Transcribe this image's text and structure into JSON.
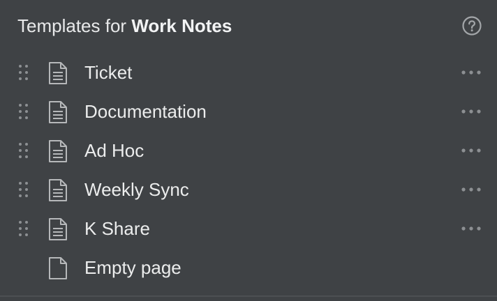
{
  "header": {
    "title_prefix": "Templates for",
    "title_bold": "Work Notes",
    "help_icon": "question-circle-icon"
  },
  "templates": [
    {
      "label": "Ticket",
      "icon": "document-lines-icon"
    },
    {
      "label": "Documentation",
      "icon": "document-lines-icon"
    },
    {
      "label": "Ad Hoc",
      "icon": "document-lines-icon"
    },
    {
      "label": "Weekly Sync",
      "icon": "document-lines-icon"
    },
    {
      "label": "K Share",
      "icon": "document-lines-icon"
    }
  ],
  "empty_page": {
    "label": "Empty page",
    "icon": "document-blank-icon"
  },
  "colors": {
    "background": "#3f4245",
    "text": "#eceded",
    "muted_icon": "#9b9ea1"
  }
}
